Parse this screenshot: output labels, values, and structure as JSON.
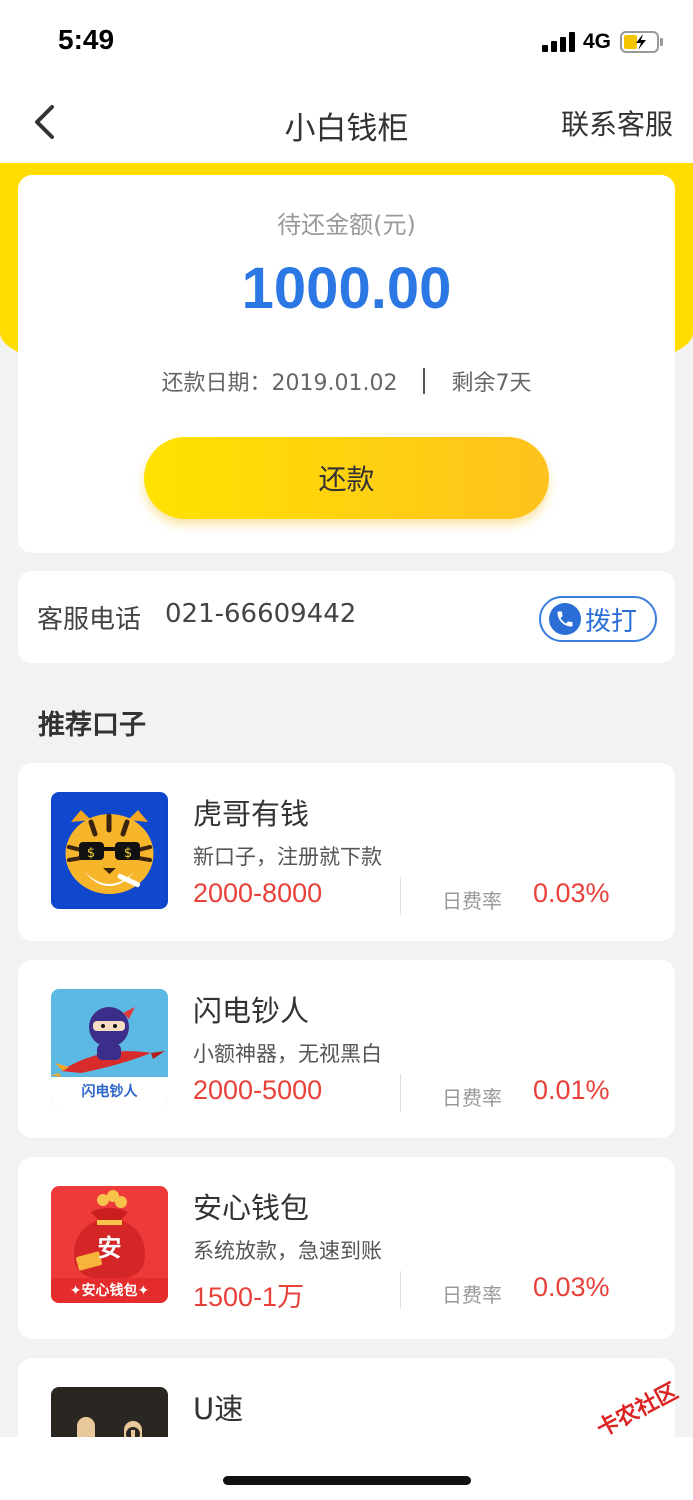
{
  "status_bar": {
    "time": "5:49",
    "network": "4G"
  },
  "nav": {
    "title": "小白钱柜",
    "contact": "联系客服"
  },
  "repay": {
    "label": "待还金额(元)",
    "amount": "1000.00",
    "date": "还款日期：2019.01.02",
    "remaining": "剩余7天",
    "button": "还款"
  },
  "service": {
    "label": "客服电话",
    "phone": "021-66609442",
    "call": "拨打"
  },
  "recommend": {
    "title": "推荐口子",
    "rate_label": "日费率",
    "items": [
      {
        "name": "虎哥有钱",
        "desc": "新口子，注册就下款",
        "range": "2000-8000",
        "rate": "0.03%",
        "logo": "tiger-logo"
      },
      {
        "name": "闪电钞人",
        "desc": "小额神器，无视黑白",
        "range": "2000-5000",
        "rate": "0.01%",
        "logo": "rocket-logo",
        "logo_text": "闪电钞人"
      },
      {
        "name": "安心钱包",
        "desc": "系统放款，急速到账",
        "range": "1500-1万",
        "rate": "0.03%",
        "logo": "moneybag-logo",
        "logo_text": "✦安心钱包✦",
        "bag_char": "安"
      },
      {
        "name": "U速",
        "logo": "u-speed-logo"
      }
    ]
  },
  "watermark": "卡农社区",
  "colors": {
    "accent_yellow": "#ffdd00",
    "amount_blue": "#2b78e4",
    "rate_red": "#e8413a"
  }
}
